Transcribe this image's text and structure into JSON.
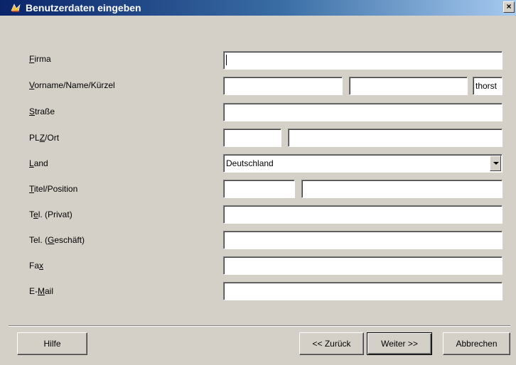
{
  "window": {
    "title": "Benutzerdaten eingeben",
    "close_glyph": "×",
    "icon": "app-icon"
  },
  "fields": {
    "firma": {
      "label": "Firma",
      "accesskey": "F",
      "value": ""
    },
    "name": {
      "label": "Vorname/Name/Kürzel",
      "accesskey": "V",
      "vorname": "",
      "nachname": "",
      "kuerzel": "thorst"
    },
    "strasse": {
      "label": "Straße",
      "accesskey": "S",
      "value": ""
    },
    "plz_ort": {
      "label": "PLZ/Ort",
      "accesskey": "Z",
      "plz": "",
      "ort": ""
    },
    "land": {
      "label": "Land",
      "accesskey": "L",
      "value": "Deutschland"
    },
    "titel": {
      "label": "Titel/Position",
      "accesskey": "T",
      "titel": "",
      "position": ""
    },
    "tel_privat": {
      "label": "Tel. (Privat)",
      "accesskey": "e",
      "value": ""
    },
    "tel_geschaeft": {
      "label": "Tel. (Geschäft)",
      "accesskey": "G",
      "value": ""
    },
    "fax": {
      "label": "Fax",
      "accesskey": "x",
      "value": ""
    },
    "email": {
      "label": "E-Mail",
      "accesskey": "M",
      "value": ""
    }
  },
  "buttons": {
    "help": "Hilfe",
    "back": "<< Zurück",
    "next": "Weiter >>",
    "cancel": "Abbrechen"
  }
}
